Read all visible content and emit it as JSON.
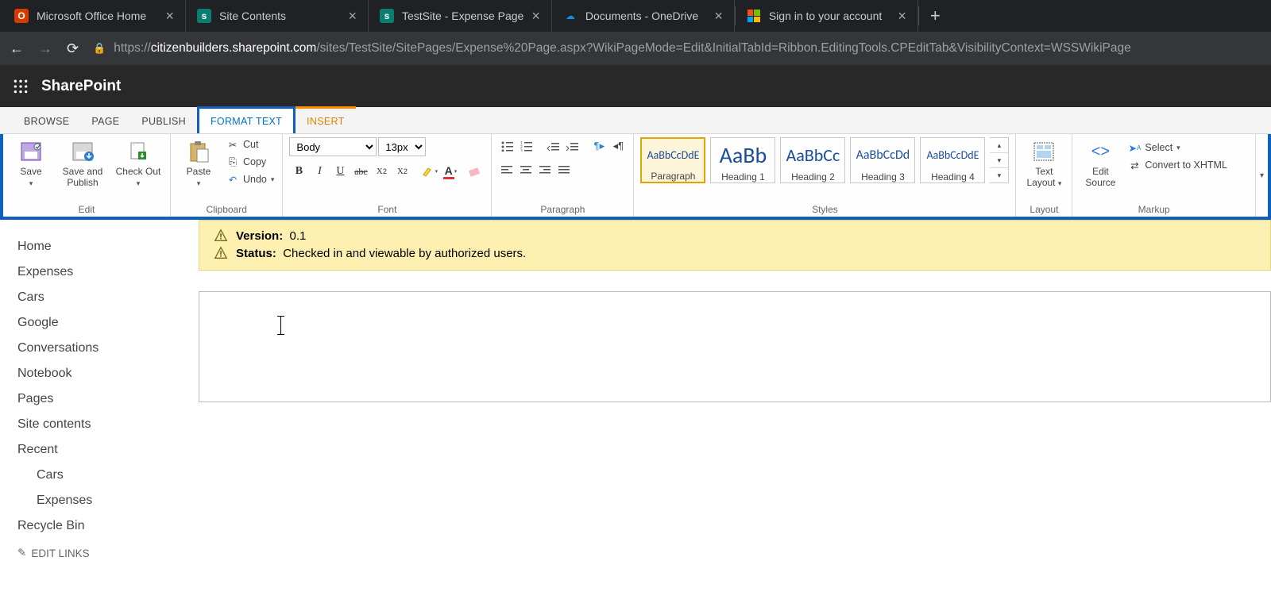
{
  "browser": {
    "tabs": [
      {
        "title": "Microsoft Office Home"
      },
      {
        "title": "Site Contents"
      },
      {
        "title": "TestSite - Expense Page"
      },
      {
        "title": "Documents - OneDrive"
      },
      {
        "title": "Sign in to your account"
      }
    ],
    "url_host": "citizenbuilders.sharepoint.com",
    "url_prefix": "https://",
    "url_path": "/sites/TestSite/SitePages/Expense%20Page.aspx?WikiPageMode=Edit&InitialTabId=Ribbon.EditingTools.CPEditTab&VisibilityContext=WSSWikiPage"
  },
  "suite": {
    "title": "SharePoint"
  },
  "ribbon": {
    "tabs": {
      "browse": "BROWSE",
      "page": "PAGE",
      "publish": "PUBLISH",
      "format_text": "FORMAT TEXT",
      "insert": "INSERT"
    },
    "edit": {
      "save": "Save",
      "save_publish": "Save and\nPublish",
      "checkout": "Check Out",
      "label": "Edit"
    },
    "clipboard": {
      "paste": "Paste",
      "cut": "Cut",
      "copy": "Copy",
      "undo": "Undo",
      "label": "Clipboard"
    },
    "font": {
      "name": "Body",
      "size": "13px",
      "label": "Font"
    },
    "paragraph": {
      "label": "Paragraph"
    },
    "styles": {
      "items": [
        {
          "preview": "AaBbCcDdE",
          "name": "Paragraph",
          "size": "14px"
        },
        {
          "preview": "AaBb",
          "name": "Heading 1",
          "size": "28px"
        },
        {
          "preview": "AaBbCc",
          "name": "Heading 2",
          "size": "22px"
        },
        {
          "preview": "AaBbCcDd",
          "name": "Heading 3",
          "size": "16px"
        },
        {
          "preview": "AaBbCcDdE",
          "name": "Heading 4",
          "size": "14px"
        }
      ],
      "label": "Styles"
    },
    "layout": {
      "text_layout": "Text\nLayout",
      "label": "Layout"
    },
    "markup": {
      "edit_source": "Edit\nSource",
      "select": "Select",
      "convert": "Convert to XHTML",
      "label": "Markup"
    }
  },
  "nav": {
    "items": [
      "Home",
      "Expenses",
      "Cars",
      "Google",
      "Conversations",
      "Notebook",
      "Pages",
      "Site contents",
      "Recent"
    ],
    "recent": [
      "Cars",
      "Expenses"
    ],
    "recycle": "Recycle Bin",
    "edit_links": "EDIT LINKS"
  },
  "status": {
    "version_label": "Version:",
    "version_value": "0.1",
    "status_label": "Status:",
    "status_value": "Checked in and viewable by authorized users."
  }
}
